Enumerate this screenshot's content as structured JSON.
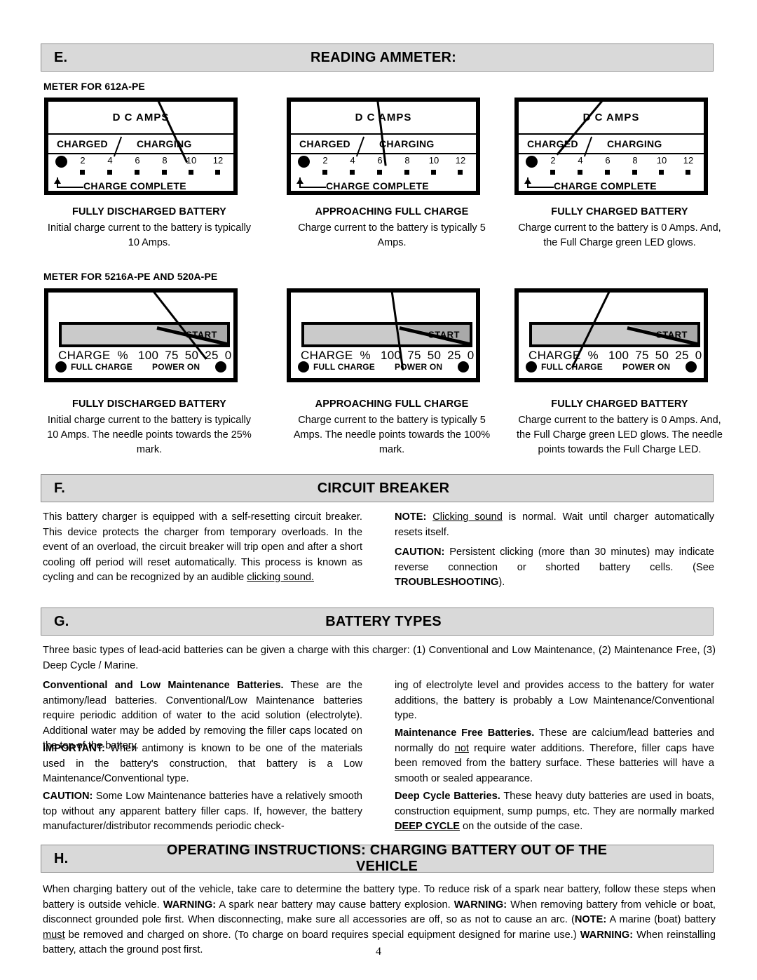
{
  "page": {
    "number": "4"
  },
  "sections": {
    "e": {
      "letter": "E.",
      "title": "READING AMMETER:"
    },
    "f": {
      "letter": "F.",
      "title": "CIRCUIT BREAKER"
    },
    "g": {
      "letter": "G.",
      "title": "BATTERY TYPES"
    },
    "h": {
      "letter": "H.",
      "title": "OPERATING INSTRUCTIONS: CHARGING BATTERY OUT OF THE VEHICLE"
    }
  },
  "ammeter": {
    "group1_label": "METER FOR 612A-PE",
    "group2_label": "METER FOR 5216A-PE AND 520A-PE",
    "meter612": {
      "title": "D C AMPS",
      "charged": "CHARGED",
      "charging": "CHARGING",
      "scale": [
        "2",
        "4",
        "6",
        "8",
        "10",
        "12"
      ],
      "charge_complete": "CHARGE COMPLETE"
    },
    "meter5216": {
      "start": "START",
      "charge_label": "CHARGE",
      "percent_symbol": "%",
      "scale": [
        "100",
        "75",
        "50",
        "25",
        "0"
      ],
      "full_charge": "FULL CHARGE",
      "power_on": "POWER ON"
    },
    "captions_row1": [
      {
        "title": "FULLY DISCHARGED BATTERY",
        "body": "Initial charge current to the battery is typically 10 Amps."
      },
      {
        "title": "APPROACHING FULL CHARGE",
        "body": "Charge current to the battery is typically 5 Amps."
      },
      {
        "title": "FULLY CHARGED BATTERY",
        "body": "Charge current to the battery is 0 Amps. And, the Full Charge green LED glows."
      }
    ],
    "captions_row2": [
      {
        "title": "FULLY DISCHARGED BATTERY",
        "body": "Initial charge current to the battery is typically 10 Amps. The needle points towards the 25% mark."
      },
      {
        "title": "APPROACHING FULL CHARGE",
        "body": "Charge current to the battery is typically 5 Amps. The needle points towards the 100% mark."
      },
      {
        "title": "FULLY CHARGED BATTERY",
        "body": "Charge current to the battery is 0 Amps. And, the Full Charge green LED glows. The needle points towards the Full Charge LED."
      }
    ]
  },
  "circuit_breaker": {
    "left_paragraph_pre": "This battery charger is equipped with a self-resetting circuit breaker. This device protects the charger from temporary overloads. In the event of an overload, the circuit breaker will trip open and after a short cooling off period will reset automatically. This process is known as cycling and can be recognized by an audible ",
    "left_paragraph_underline": "clicking sound.",
    "note_label": "NOTE:",
    "note_underline": "Clicking sound",
    "note_rest": " is normal. Wait until charger automatically resets itself.",
    "caution_label": "CAUTION:",
    "caution_text": " Persistent clicking (more than 30 minutes) may indicate reverse connection or shorted battery cells. (See ",
    "caution_bold": "TROUBLESHOOTING",
    "caution_end": ")."
  },
  "battery_types": {
    "intro": "Three basic types of lead-acid batteries can be given a charge with this charger: (1) Conventional and Low Maintenance, (2) Maintenance Free, (3) Deep Cycle / Marine.",
    "conventional_title": "Conventional and Low Maintenance Batteries.",
    "conventional_body": " These are the antimony/lead batteries. Conventional/Low Maintenance batteries require periodic addition of water to the acid solution (electrolyte). Additional water may be added by removing the filler caps located on the top of the battery.",
    "important_label": "IMPORTANT:",
    "important_body": " When antimony is known to be one of the materials used in the battery's construction, that battery is a Low Maintenance/Conventional type.",
    "caution_label": "CAUTION:",
    "caution_body": " Some Low Maintenance batteries have a relatively smooth top without any apparent battery filler caps. If, however, the battery manufacturer/distributor recommends periodic check-",
    "right_continuation": "ing of electrolyte level and provides access to the battery for water additions, the battery is probably a Low Maintenance/Conventional type.",
    "maintfree_title": "Maintenance Free Batteries.",
    "maintfree_body_a": " These are calcium/lead batteries and normally do ",
    "maintfree_not": "not",
    "maintfree_body_b": " require water additions. Therefore, filler caps have been removed from the battery surface. These batteries will have a smooth or sealed appearance.",
    "deepcycle_title": "Deep Cycle Batteries.",
    "deepcycle_body_a": " These heavy duty batteries are used in boats, construction equipment, sump pumps, etc. They are normally marked ",
    "deepcycle_mark": "DEEP CYCLE",
    "deepcycle_body_b": " on the outside of the case."
  },
  "operating": {
    "p1": "When charging battery out of the vehicle, take care to determine the battery type. To reduce risk of a spark near battery, follow these steps when battery is outside vehicle. ",
    "warn1_label": "WARNING:",
    "warn1_text": " A spark near battery may cause battery explosion. ",
    "warn2_label": "WARNING:",
    "warn2_text": " When removing battery from vehicle or boat, disconnect grounded pole first. When disconnecting, make sure all accessories are off, so as not to cause an arc. (",
    "note_label": "NOTE:",
    "note_text_a": " A marine (boat) battery ",
    "note_must": "must",
    "note_text_b": " be removed and charged on shore. (To charge on board requires special equipment designed for marine use.) ",
    "warn3_label": "WARNING:",
    "warn3_text": " When reinstalling battery, attach the ground post first."
  }
}
